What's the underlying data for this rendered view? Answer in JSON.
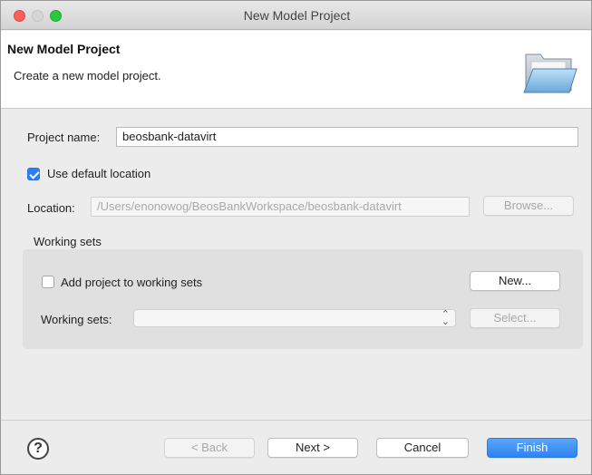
{
  "window": {
    "title": "New Model Project"
  },
  "banner": {
    "title": "New Model Project",
    "description": "Create a new model project."
  },
  "form": {
    "project_name_label": "Project name:",
    "project_name_value": "beosbank-datavirt",
    "use_default_location_label": "Use default location",
    "use_default_location_checked": true,
    "location_label": "Location:",
    "location_value": "/Users/enonowog/BeosBankWorkspace/beosbank-datavirt",
    "browse_label": "Browse..."
  },
  "working_sets": {
    "group_label": "Working sets",
    "add_to_working_sets_label": "Add project to working sets",
    "add_to_working_sets_checked": false,
    "new_label": "New...",
    "working_sets_label": "Working sets:",
    "working_sets_value": "",
    "select_label": "Select..."
  },
  "footer": {
    "help_symbol": "?",
    "back_label": "< Back",
    "next_label": "Next >",
    "cancel_label": "Cancel",
    "finish_label": "Finish"
  },
  "icons": {
    "banner_icon": "folder-open-icon",
    "help_icon": "help-icon"
  },
  "colors": {
    "accent": "#2f7ef6",
    "close": "#ff5f57",
    "maximize": "#28c940"
  }
}
